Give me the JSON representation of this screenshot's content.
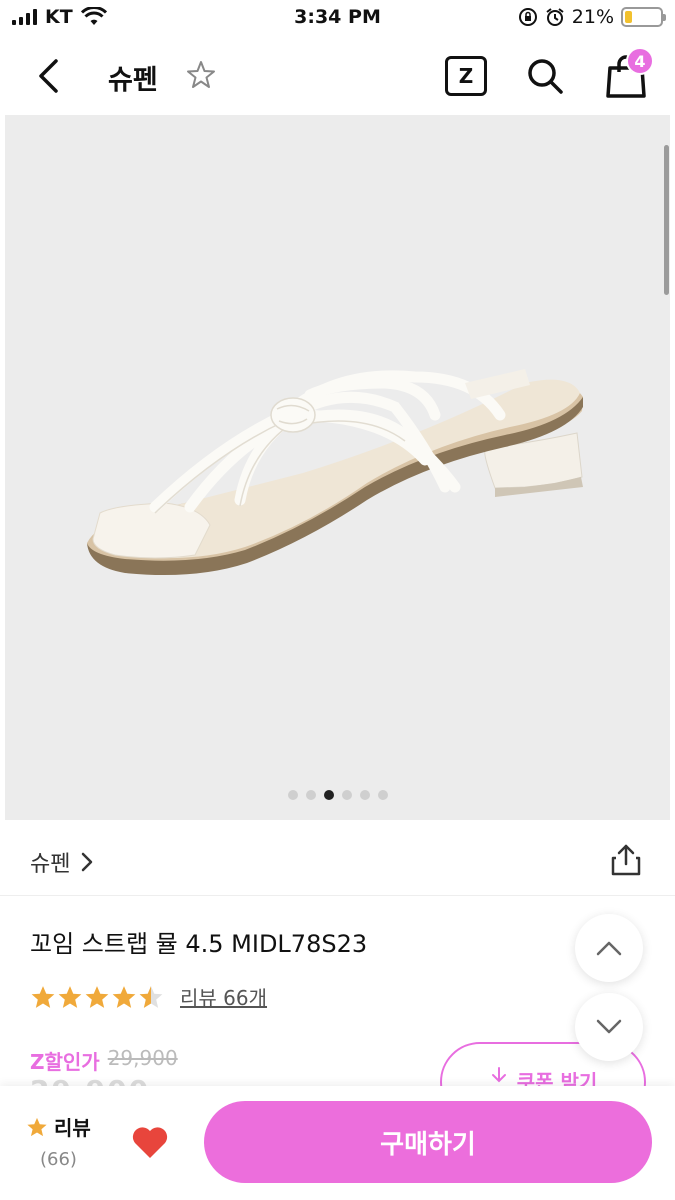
{
  "status_bar": {
    "carrier": "KT",
    "time": "3:34 PM",
    "battery_percent": "21%",
    "battery_level": 0.21,
    "icons": [
      "signal-icon",
      "wifi-icon",
      "lock-rotation-icon",
      "alarm-icon",
      "battery-icon"
    ]
  },
  "header": {
    "title": "슈펜",
    "z_label": "Z",
    "cart_badge": "4",
    "icons": [
      "back-icon",
      "star-outline-icon",
      "search-icon",
      "shopping-bag-icon"
    ]
  },
  "gallery": {
    "image": "white-strappy-sandal",
    "slide_count": 6,
    "active_slide": 3
  },
  "brand": {
    "name": "슈펜"
  },
  "product": {
    "name": "꼬임 스트랩 뮬 4.5 MIDL78S23",
    "rating": 4.5,
    "review_link": "리뷰 66개",
    "z_price_label": "Z할인가",
    "original_price": "29,900"
  },
  "coupon": {
    "label": "쿠폰 받기"
  },
  "bottom": {
    "review_label": "리뷰",
    "review_count": "(66)",
    "buy_label": "구매하기"
  },
  "colors": {
    "accent": "#ec6edc",
    "star": "#f0a93a",
    "heart": "#e8453c"
  }
}
